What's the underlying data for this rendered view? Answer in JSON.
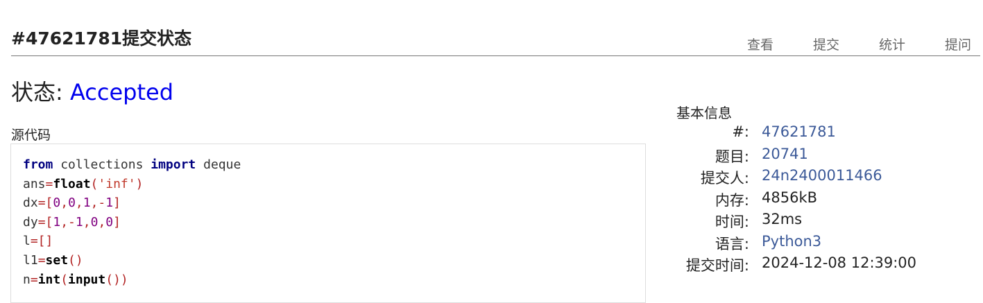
{
  "page": {
    "title": "#47621781提交状态",
    "nav": [
      "查看",
      "提交",
      "统计",
      "提问"
    ]
  },
  "status": {
    "label": "状态:",
    "value": "Accepted"
  },
  "source": {
    "label": "源代码",
    "lines": [
      "from collections import deque",
      "ans=float('inf')",
      "dx=[0,0,1,-1]",
      "dy=[1,-1,0,0]",
      "l=[]",
      "l1=set()",
      "n=int(input())"
    ]
  },
  "info": {
    "title": "基本信息",
    "rows": [
      {
        "key": "#:",
        "value": "47621781"
      },
      {
        "key": "题目:",
        "value": "20741"
      },
      {
        "key": "提交人:",
        "value": "24n2400011466"
      },
      {
        "key": "内存:",
        "value": "4856kB"
      },
      {
        "key": "时间:",
        "value": "32ms"
      },
      {
        "key": "语言:",
        "value": "Python3"
      },
      {
        "key": "提交时间:",
        "value": "2024-12-08 12:39:00"
      }
    ]
  }
}
